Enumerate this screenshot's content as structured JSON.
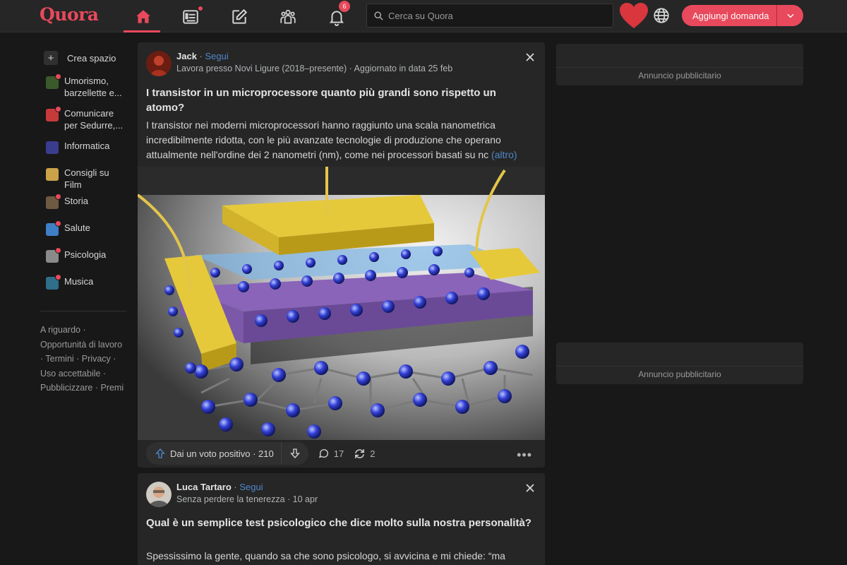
{
  "header": {
    "logo": "Quora",
    "search_placeholder": "Cerca su Quora",
    "notification_count": "6",
    "add_question_label": "Aggiungi domanda"
  },
  "sidebar": {
    "create_label": "Crea spazio",
    "items": [
      {
        "label": "Umorismo, barzellette e...",
        "color": "#3b5a2c"
      },
      {
        "label": "Comunicare per Sedurre,...",
        "color": "#c73a3a"
      },
      {
        "label": "Informatica",
        "color": "#3a3c8e"
      },
      {
        "label": "Consigli su Film",
        "color": "#caa24a"
      },
      {
        "label": "Storia",
        "color": "#6e5a40"
      },
      {
        "label": "Salute",
        "color": "#3f7fc6"
      },
      {
        "label": "Psicologia",
        "color": "#8a8a8a"
      },
      {
        "label": "Musica",
        "color": "#2f6f8a"
      }
    ],
    "footer": "A riguardo · Opportunità di lavoro · Termini · Privacy · Uso accettabile · Pubblicizzare · Premi"
  },
  "posts": [
    {
      "author": "Jack",
      "follow_label": "Segui",
      "credential": "Lavora presso Novi Ligure (2018–presente) · Aggiornato in data 25 feb",
      "title": "I transistor in un microprocessore quanto più grandi sono rispetto un atomo?",
      "text": "I transistor nei moderni microprocessori hanno raggiunto una scala nanometrica incredibilmente ridotta, con le più avanzate tecnologie di produzione che operano attualmente nell'ordine dei 2 nanometri (nm), come nei processori basati su nc",
      "more_label": "(altro)",
      "upvote_label": "Dai un voto positivo",
      "upvotes": "210",
      "comments": "17",
      "shares": "2"
    },
    {
      "author": "Luca Tartaro",
      "follow_label": "Segui",
      "credential": "Senza perdere la tenerezza · 10 apr",
      "title": "Qual è un semplice test psicologico che dice molto sulla nostra personalità?",
      "text": "Spessissimo la gente, quando sa che sono psicologo, si avvicina e mi chiede: “ma"
    }
  ],
  "ads": [
    {
      "label": "Annuncio pubblicitario"
    },
    {
      "label": "Annuncio pubblicitario"
    }
  ],
  "colors": {
    "accent": "#e8495c",
    "link": "#4d88c8",
    "background": "#181818",
    "card": "#262626"
  }
}
